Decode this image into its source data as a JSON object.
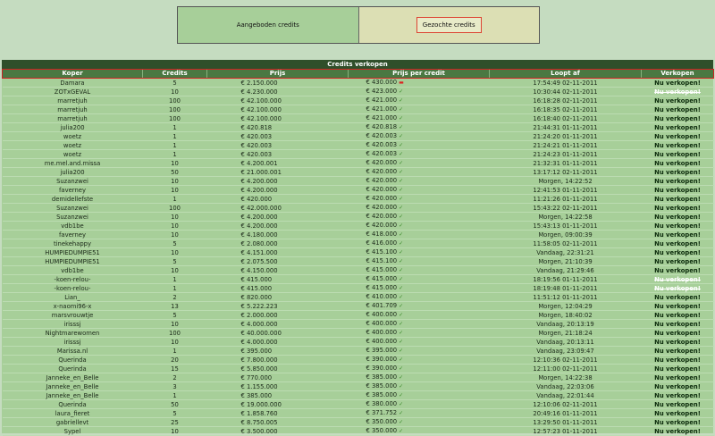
{
  "tabs": {
    "offered": "Aangeboden credits",
    "wanted": "Gezochte credits"
  },
  "panel_title": "Credits verkopen",
  "columns": [
    "Koper",
    "Credits",
    "Prijs",
    "Prijs per credit",
    "Loopt af",
    "Verkopen"
  ],
  "rows": [
    {
      "buyer": "Damara",
      "credits": "5",
      "price": "€ 2.150.000",
      "ppc": "€ 430.000",
      "mark": "down",
      "expires": "17:54:49 02-11-2011",
      "action": "Nu verkopen!",
      "disabled": false
    },
    {
      "buyer": "ZOTxGEVAL",
      "credits": "10",
      "price": "€ 4.230.000",
      "ppc": "€ 423.000",
      "mark": "up",
      "expires": "10:30:44 02-11-2011",
      "action": "Nu verkopen!",
      "disabled": true
    },
    {
      "buyer": "marretjuh",
      "credits": "100",
      "price": "€ 42.100.000",
      "ppc": "€ 421.000",
      "mark": "up",
      "expires": "16:18:28 02-11-2011",
      "action": "Nu verkopen!",
      "disabled": false
    },
    {
      "buyer": "marretjuh",
      "credits": "100",
      "price": "€ 42.100.000",
      "ppc": "€ 421.000",
      "mark": "up",
      "expires": "16:18:35 02-11-2011",
      "action": "Nu verkopen!",
      "disabled": false
    },
    {
      "buyer": "marretjuh",
      "credits": "100",
      "price": "€ 42.100.000",
      "ppc": "€ 421.000",
      "mark": "up",
      "expires": "16:18:40 02-11-2011",
      "action": "Nu verkopen!",
      "disabled": false
    },
    {
      "buyer": "julia200",
      "credits": "1",
      "price": "€ 420.818",
      "ppc": "€ 420.818",
      "mark": "up",
      "expires": "21:44:31 01-11-2011",
      "action": "Nu verkopen!",
      "disabled": false
    },
    {
      "buyer": "woetz",
      "credits": "1",
      "price": "€ 420.003",
      "ppc": "€ 420.003",
      "mark": "up",
      "expires": "21:24:20 01-11-2011",
      "action": "Nu verkopen!",
      "disabled": false
    },
    {
      "buyer": "woetz",
      "credits": "1",
      "price": "€ 420.003",
      "ppc": "€ 420.003",
      "mark": "up",
      "expires": "21:24:21 01-11-2011",
      "action": "Nu verkopen!",
      "disabled": false
    },
    {
      "buyer": "woetz",
      "credits": "1",
      "price": "€ 420.003",
      "ppc": "€ 420.003",
      "mark": "up",
      "expires": "21:24:23 01-11-2011",
      "action": "Nu verkopen!",
      "disabled": false
    },
    {
      "buyer": "me.mel.and.missa",
      "credits": "10",
      "price": "€ 4.200.001",
      "ppc": "€ 420.000",
      "mark": "up",
      "expires": "21:32:31 01-11-2011",
      "action": "Nu verkopen!",
      "disabled": false
    },
    {
      "buyer": "julia200",
      "credits": "50",
      "price": "€ 21.000.001",
      "ppc": "€ 420.000",
      "mark": "up",
      "expires": "13:17:12 02-11-2011",
      "action": "Nu verkopen!",
      "disabled": false
    },
    {
      "buyer": "Suzanzwei",
      "credits": "10",
      "price": "€ 4.200.000",
      "ppc": "€ 420.000",
      "mark": "up",
      "expires": "Morgen, 14:22:52",
      "action": "Nu verkopen!",
      "disabled": false
    },
    {
      "buyer": "faverney",
      "credits": "10",
      "price": "€ 4.200.000",
      "ppc": "€ 420.000",
      "mark": "up",
      "expires": "12:41:53 01-11-2011",
      "action": "Nu verkopen!",
      "disabled": false
    },
    {
      "buyer": "demidellefste",
      "credits": "1",
      "price": "€ 420.000",
      "ppc": "€ 420.000",
      "mark": "up",
      "expires": "11:21:26 01-11-2011",
      "action": "Nu verkopen!",
      "disabled": false
    },
    {
      "buyer": "Suzanzwei",
      "credits": "100",
      "price": "€ 42.000.000",
      "ppc": "€ 420.000",
      "mark": "up",
      "expires": "15:43:22 02-11-2011",
      "action": "Nu verkopen!",
      "disabled": false
    },
    {
      "buyer": "Suzanzwei",
      "credits": "10",
      "price": "€ 4.200.000",
      "ppc": "€ 420.000",
      "mark": "up",
      "expires": "Morgen, 14:22:58",
      "action": "Nu verkopen!",
      "disabled": false
    },
    {
      "buyer": "vdb1be",
      "credits": "10",
      "price": "€ 4.200.000",
      "ppc": "€ 420.000",
      "mark": "up",
      "expires": "15:43:13 01-11-2011",
      "action": "Nu verkopen!",
      "disabled": false
    },
    {
      "buyer": "faverney",
      "credits": "10",
      "price": "€ 4.180.000",
      "ppc": "€ 418.000",
      "mark": "up",
      "expires": "Morgen, 09:00:39",
      "action": "Nu verkopen!",
      "disabled": false
    },
    {
      "buyer": "tinekehappy",
      "credits": "5",
      "price": "€ 2.080.000",
      "ppc": "€ 416.000",
      "mark": "up",
      "expires": "11:58:05 02-11-2011",
      "action": "Nu verkopen!",
      "disabled": false
    },
    {
      "buyer": "HUMPIEDUMPIE51",
      "credits": "10",
      "price": "€ 4.151.000",
      "ppc": "€ 415.100",
      "mark": "up",
      "expires": "Vandaag, 22:31:21",
      "action": "Nu verkopen!",
      "disabled": false
    },
    {
      "buyer": "HUMPIEDUMPIE51",
      "credits": "5",
      "price": "€ 2.075.500",
      "ppc": "€ 415.100",
      "mark": "up",
      "expires": "Morgen, 21:10:39",
      "action": "Nu verkopen!",
      "disabled": false
    },
    {
      "buyer": "vdb1be",
      "credits": "10",
      "price": "€ 4.150.000",
      "ppc": "€ 415.000",
      "mark": "up",
      "expires": "Vandaag, 21:29:46",
      "action": "Nu verkopen!",
      "disabled": false
    },
    {
      "buyer": "-koen-relou-",
      "credits": "1",
      "price": "€ 415.000",
      "ppc": "€ 415.000",
      "mark": "up",
      "expires": "18:19:56 01-11-2011",
      "action": "Nu verkopen!",
      "disabled": true
    },
    {
      "buyer": "-koen-relou-",
      "credits": "1",
      "price": "€ 415.000",
      "ppc": "€ 415.000",
      "mark": "up",
      "expires": "18:19:48 01-11-2011",
      "action": "Nu verkopen!",
      "disabled": true
    },
    {
      "buyer": "Lian_",
      "credits": "2",
      "price": "€ 820.000",
      "ppc": "€ 410.000",
      "mark": "up",
      "expires": "11:51:12 01-11-2011",
      "action": "Nu verkopen!",
      "disabled": false
    },
    {
      "buyer": "x-naomi96-x",
      "credits": "13",
      "price": "€ 5.222.223",
      "ppc": "€ 401.709",
      "mark": "up",
      "expires": "Morgen, 12:04:29",
      "action": "Nu verkopen!",
      "disabled": false
    },
    {
      "buyer": "marsvrouwtje",
      "credits": "5",
      "price": "€ 2.000.000",
      "ppc": "€ 400.000",
      "mark": "up",
      "expires": "Morgen, 18:40:02",
      "action": "Nu verkopen!",
      "disabled": false
    },
    {
      "buyer": "irisssj",
      "credits": "10",
      "price": "€ 4.000.000",
      "ppc": "€ 400.000",
      "mark": "up",
      "expires": "Vandaag, 20:13:19",
      "action": "Nu verkopen!",
      "disabled": false
    },
    {
      "buyer": "Nightmarewomen",
      "credits": "100",
      "price": "€ 40.000.000",
      "ppc": "€ 400.000",
      "mark": "up",
      "expires": "Morgen, 21:18:24",
      "action": "Nu verkopen!",
      "disabled": false
    },
    {
      "buyer": "irisssj",
      "credits": "10",
      "price": "€ 4.000.000",
      "ppc": "€ 400.000",
      "mark": "up",
      "expires": "Vandaag, 20:13:11",
      "action": "Nu verkopen!",
      "disabled": false
    },
    {
      "buyer": "Marissa.nl",
      "credits": "1",
      "price": "€ 395.000",
      "ppc": "€ 395.000",
      "mark": "up",
      "expires": "Vandaag, 23:09:47",
      "action": "Nu verkopen!",
      "disabled": false
    },
    {
      "buyer": "Querinda",
      "credits": "20",
      "price": "€ 7.800.000",
      "ppc": "€ 390.000",
      "mark": "up",
      "expires": "12:10:36 02-11-2011",
      "action": "Nu verkopen!",
      "disabled": false
    },
    {
      "buyer": "Querinda",
      "credits": "15",
      "price": "€ 5.850.000",
      "ppc": "€ 390.000",
      "mark": "up",
      "expires": "12:11:00 02-11-2011",
      "action": "Nu verkopen!",
      "disabled": false
    },
    {
      "buyer": "Janneke_en_Belle",
      "credits": "2",
      "price": "€ 770.000",
      "ppc": "€ 385.000",
      "mark": "up",
      "expires": "Morgen, 14:22:38",
      "action": "Nu verkopen!",
      "disabled": false
    },
    {
      "buyer": "Janneke_en_Belle",
      "credits": "3",
      "price": "€ 1.155.000",
      "ppc": "€ 385.000",
      "mark": "up",
      "expires": "Vandaag, 22:03:06",
      "action": "Nu verkopen!",
      "disabled": false
    },
    {
      "buyer": "Janneke_en_Belle",
      "credits": "1",
      "price": "€ 385.000",
      "ppc": "€ 385.000",
      "mark": "up",
      "expires": "Vandaag, 22:01:44",
      "action": "Nu verkopen!",
      "disabled": false
    },
    {
      "buyer": "Querinda",
      "credits": "50",
      "price": "€ 19.000.000",
      "ppc": "€ 380.000",
      "mark": "up",
      "expires": "12:10:06 02-11-2011",
      "action": "Nu verkopen!",
      "disabled": false
    },
    {
      "buyer": "laura_fieret",
      "credits": "5",
      "price": "€ 1.858.760",
      "ppc": "€ 371.752",
      "mark": "up",
      "expires": "20:49:16 01-11-2011",
      "action": "Nu verkopen!",
      "disabled": false
    },
    {
      "buyer": "gabriellevt",
      "credits": "25",
      "price": "€ 8.750.005",
      "ppc": "€ 350.000",
      "mark": "up",
      "expires": "13:29:50 01-11-2011",
      "action": "Nu verkopen!",
      "disabled": false
    },
    {
      "buyer": "Sypel",
      "credits": "10",
      "price": "€ 3.500.000",
      "ppc": "€ 350.000",
      "mark": "up",
      "expires": "12:57:23 01-11-2011",
      "action": "Nu verkopen!",
      "disabled": false
    }
  ]
}
